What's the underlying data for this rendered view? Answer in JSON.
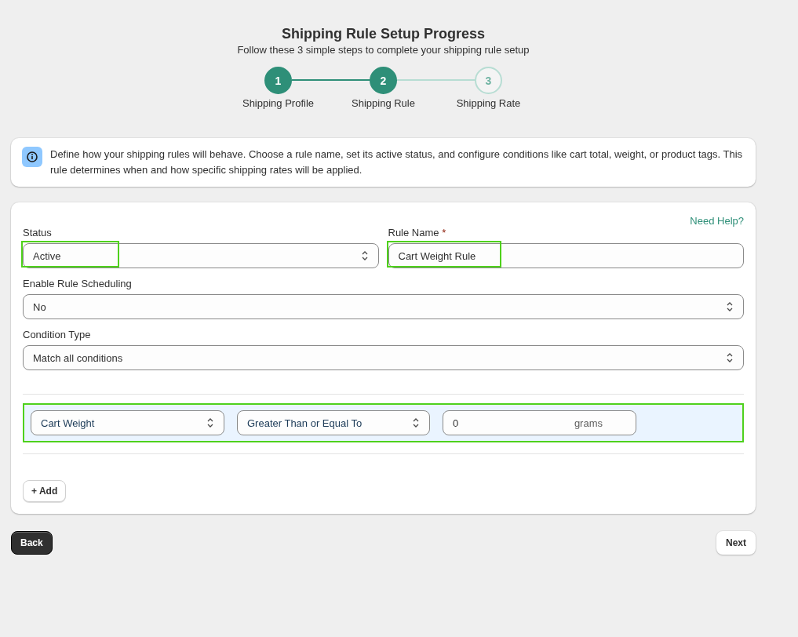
{
  "header": {
    "title": "Shipping Rule Setup Progress",
    "subtitle": "Follow these 3 simple steps to complete your shipping rule setup"
  },
  "steps": [
    {
      "number": "1",
      "label": "Shipping Profile",
      "reached": true
    },
    {
      "number": "2",
      "label": "Shipping Rule",
      "reached": true
    },
    {
      "number": "3",
      "label": "Shipping Rate",
      "reached": false
    }
  ],
  "info": {
    "text": "Define how your shipping rules will behave. Choose a rule name, set its active status, and configure conditions like cart total, weight, or product tags. This rule determines when and how specific shipping rates will be applied."
  },
  "form": {
    "help_link": "Need Help?",
    "status": {
      "label": "Status",
      "value": "Active",
      "highlighted": true
    },
    "rule_name": {
      "label": "Rule Name",
      "required_mark": "*",
      "value": "Cart Weight Rule",
      "highlighted": true
    },
    "scheduling": {
      "label": "Enable Rule Scheduling",
      "value": "No"
    },
    "condition_type": {
      "label": "Condition Type",
      "value": "Match all conditions"
    },
    "conditions": [
      {
        "field": "Cart Weight",
        "operator": "Greater Than or Equal To",
        "value": "0",
        "unit": "grams",
        "highlighted": true
      }
    ],
    "add_button": "+ Add"
  },
  "footer": {
    "back": "Back",
    "next": "Next"
  }
}
